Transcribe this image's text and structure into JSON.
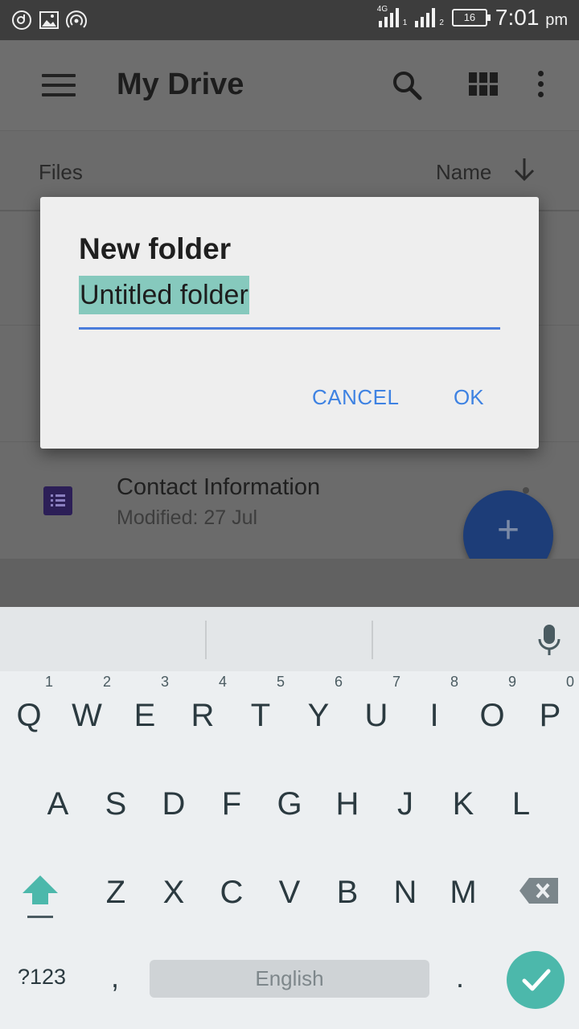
{
  "status_bar": {
    "time": "7:01",
    "ampm": "pm",
    "battery": "16",
    "net_label": "4G",
    "sim1": "1",
    "sim2": "2"
  },
  "appbar": {
    "title": "My Drive"
  },
  "filesbar": {
    "files_label": "Files",
    "sort_label": "Name"
  },
  "file_list": [
    {
      "name": "Contact Information",
      "meta": "Modified: 27 Jul"
    }
  ],
  "fab": {
    "symbol": "+"
  },
  "dialog": {
    "title": "New folder",
    "input_value": "Untitled folder",
    "cancel_label": "CANCEL",
    "ok_label": "OK",
    "accent": "#3e82e2",
    "selection_color": "#86c9bd"
  },
  "keyboard": {
    "row1": [
      "Q",
      "W",
      "E",
      "R",
      "T",
      "Y",
      "U",
      "I",
      "O",
      "P"
    ],
    "row1_hints": [
      "1",
      "2",
      "3",
      "4",
      "5",
      "6",
      "7",
      "8",
      "9",
      "0"
    ],
    "row2": [
      "A",
      "S",
      "D",
      "F",
      "G",
      "H",
      "J",
      "K",
      "L"
    ],
    "row3": [
      "Z",
      "X",
      "C",
      "V",
      "B",
      "N",
      "M"
    ],
    "symbols_label": "?123",
    "comma": ",",
    "space_label": "English",
    "period": ".",
    "enter_color": "#4cb8ab"
  }
}
